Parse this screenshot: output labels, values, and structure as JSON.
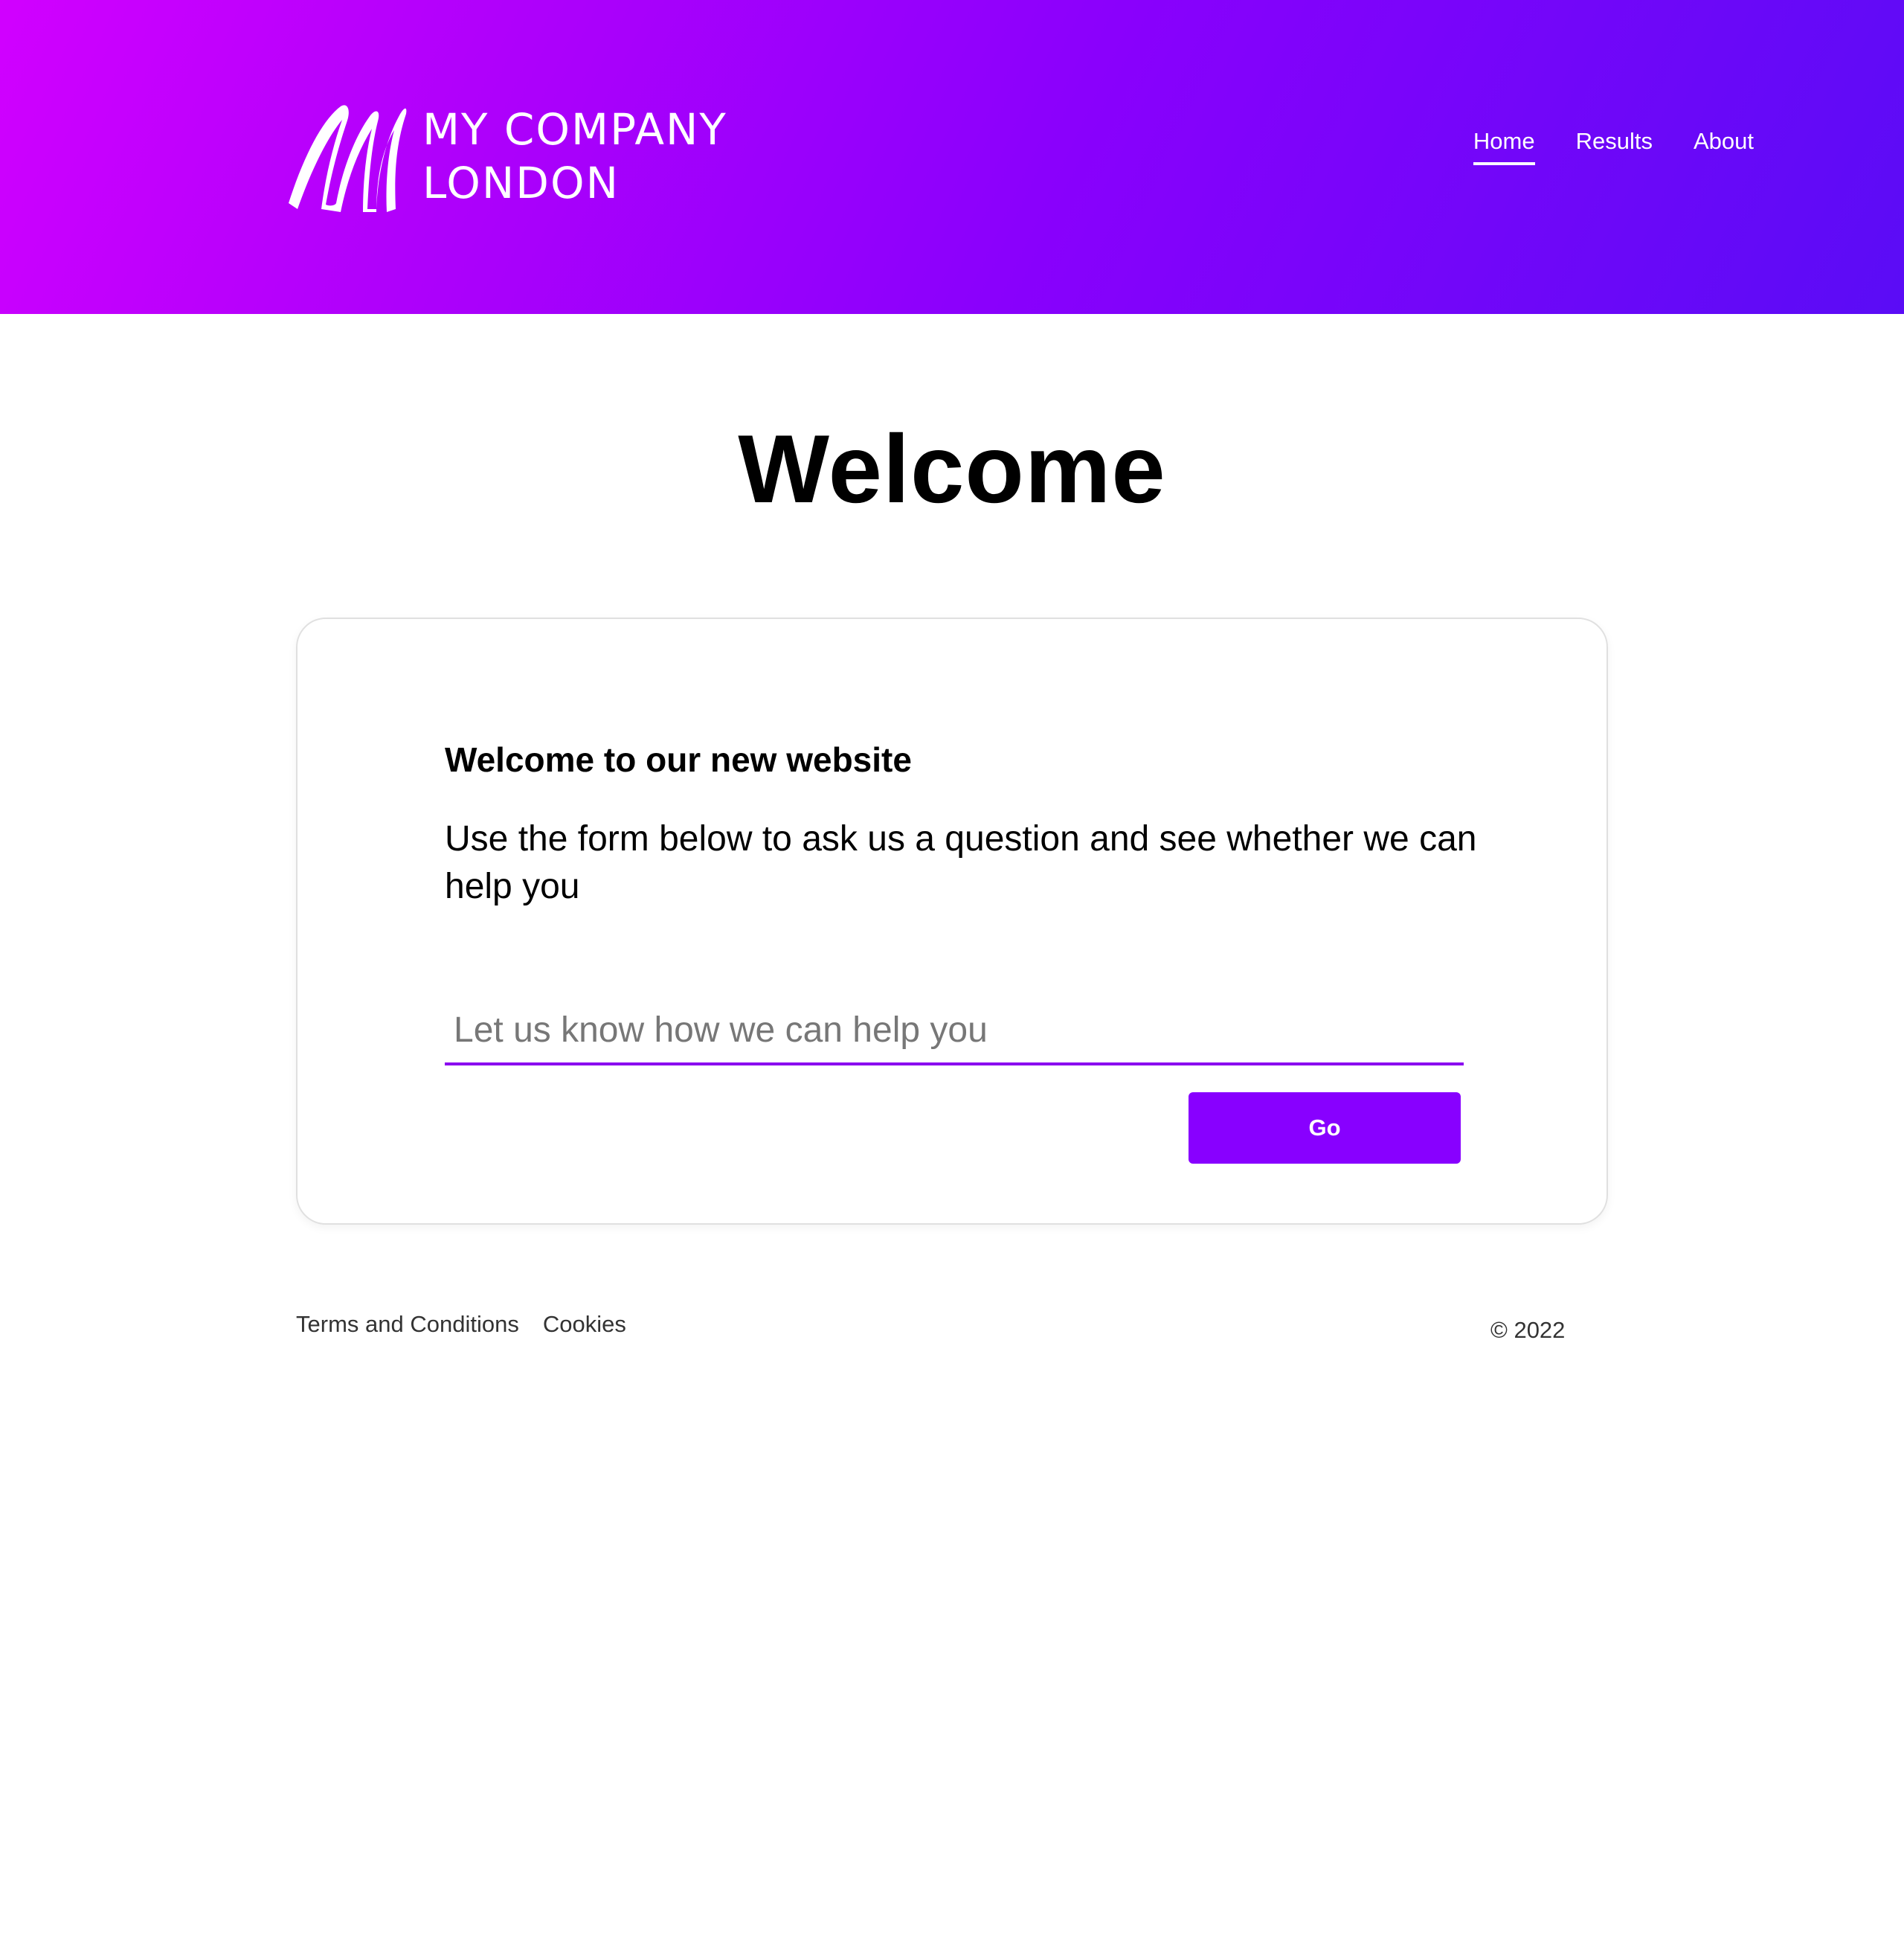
{
  "header": {
    "logo_line1": "MY COMPANY",
    "logo_line2": "LONDON",
    "logo_icon": "script-m-logo",
    "gradient": [
      "#d100ff",
      "#5a0cf6"
    ],
    "nav": [
      {
        "label": "Home",
        "active": true
      },
      {
        "label": "Results",
        "active": false
      },
      {
        "label": "About",
        "active": false
      }
    ]
  },
  "main": {
    "title": "Welcome",
    "card": {
      "heading": "Welcome to our new website",
      "body": "Use the form below to ask us a question and see whether we can help you",
      "input_placeholder": "Let us know how we can help you",
      "input_value": "",
      "button_label": "Go",
      "accent_color": "#8800ff"
    }
  },
  "footer": {
    "links": [
      "Terms and Conditions",
      "Cookies"
    ],
    "copyright": "© 2022"
  }
}
